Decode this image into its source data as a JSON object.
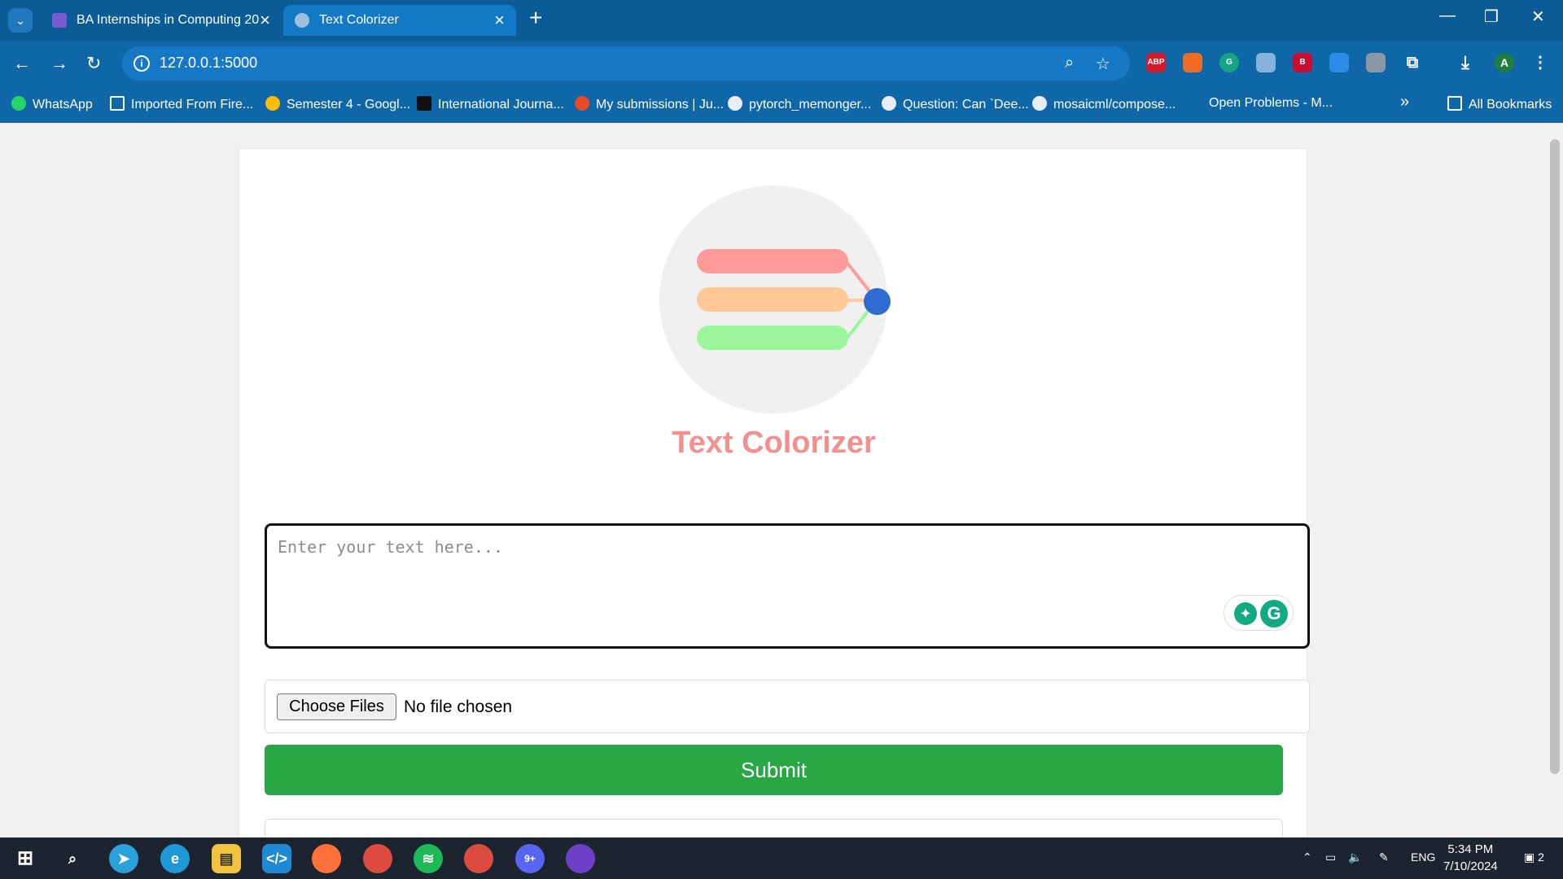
{
  "browser": {
    "tabs": [
      {
        "title": "BA Internships in Computing 20"
      },
      {
        "title": "Text Colorizer"
      }
    ],
    "new_tab_icon": "plus-icon",
    "url": "127.0.0.1:5000",
    "extensions": [
      "ABP",
      "B"
    ],
    "profile_initial": "A",
    "bookmarks": [
      {
        "label": "WhatsApp"
      },
      {
        "label": "Imported From Fire..."
      },
      {
        "label": "Semester 4 - Googl..."
      },
      {
        "label": "International Journa..."
      },
      {
        "label": "My submissions | Ju..."
      },
      {
        "label": "pytorch_memonger..."
      },
      {
        "label": "Question: Can `Dee..."
      },
      {
        "label": "mosaicml/compose..."
      },
      {
        "label": "Open Problems - M..."
      }
    ],
    "all_bookmarks_label": "All Bookmarks"
  },
  "app": {
    "title": "Text Colorizer",
    "textarea_placeholder": "Enter your text here...",
    "choose_files_label": "Choose Files",
    "no_file_label": "No file chosen",
    "submit_label": "Submit",
    "colors": {
      "red": "#ff9a9a",
      "orange": "#ffc995",
      "green": "#9cf59b",
      "blue": "#2f6bd3",
      "submit": "#28a745"
    }
  },
  "taskbar": {
    "language": "ENG",
    "time": "5:34 PM",
    "date": "7/10/2024",
    "notification_count": "2",
    "discord_badge": "9+"
  }
}
